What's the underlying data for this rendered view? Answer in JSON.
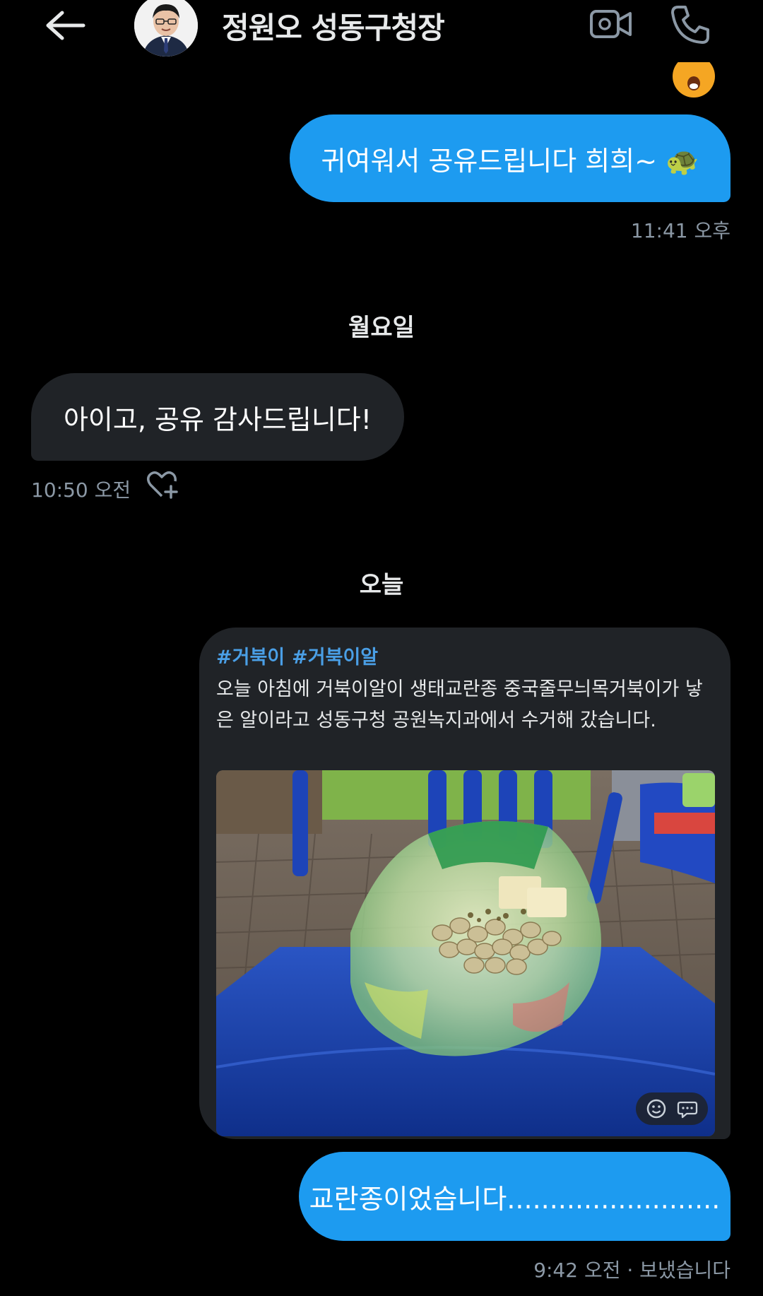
{
  "header": {
    "title": "정원오 성동구청장"
  },
  "messages": [
    {
      "text": "귀여워서 공유드립니다 희희~ 🐢",
      "time": "11:41 오후"
    },
    {
      "text": "아이고, 공유 감사드립니다!",
      "time": "10:50 오전"
    },
    {
      "text": "교란종이었습니다.........................",
      "time": "9:42 오전 · 보냈습니다"
    }
  ],
  "day_separators": [
    "월요일",
    "오늘"
  ],
  "shared_post": {
    "hashtags": [
      "#거북이",
      "#거북이알"
    ],
    "caption": "오늘 아침에 거북이알이 생태교란종 중국줄무늬목거북이가 낳은 알이라고 성동구청 공원녹지과에서 수거해 갔습니다."
  },
  "colors": {
    "background": "#000000",
    "outgoing_bubble": "#1d9bf0",
    "incoming_bubble": "#202327",
    "hashtag": "#4a9fe6",
    "muted_text": "#8b98a5"
  },
  "icons": [
    "back-arrow-icon",
    "video-call-icon",
    "phone-icon",
    "heart-plus-icon",
    "emoji-icon",
    "comment-icon"
  ]
}
